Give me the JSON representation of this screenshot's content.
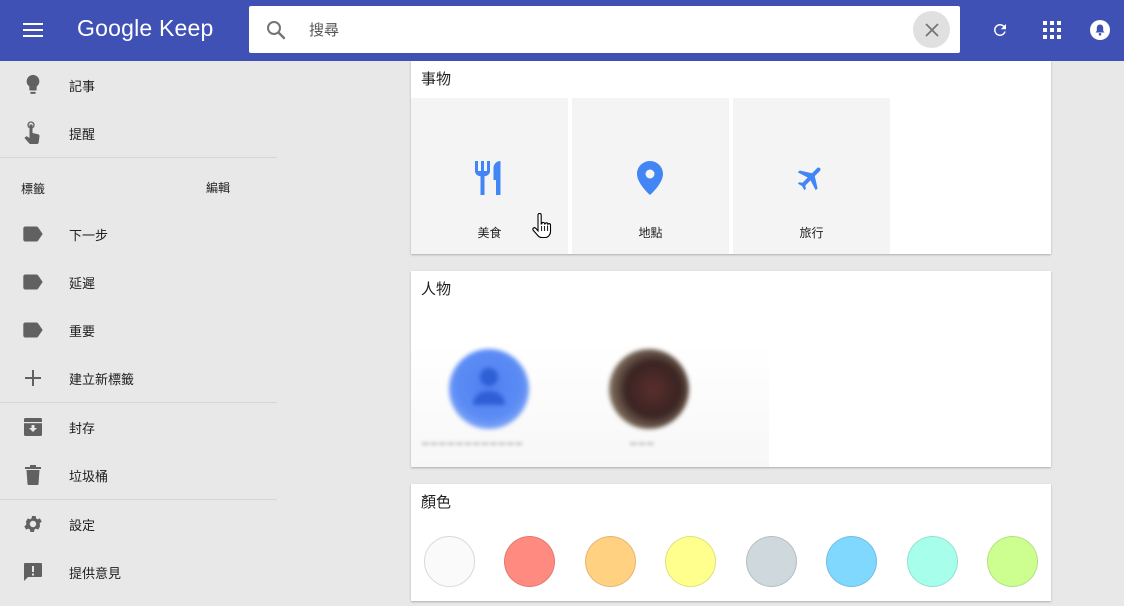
{
  "app": {
    "title": "Google Keep"
  },
  "search": {
    "placeholder": "搜尋"
  },
  "sidebar": {
    "items": [
      {
        "label": "記事",
        "icon": "lightbulb-icon"
      },
      {
        "label": "提醒",
        "icon": "reminder-hand-icon"
      }
    ],
    "labels_header": "標籤",
    "labels_edit": "編輯",
    "labels": [
      {
        "label": "下一步",
        "icon": "label-icon"
      },
      {
        "label": "延遲",
        "icon": "label-icon"
      },
      {
        "label": "重要",
        "icon": "label-icon"
      }
    ],
    "create_label": "建立新標籤",
    "archive": "封存",
    "trash": "垃圾桶",
    "settings": "設定",
    "feedback": "提供意見"
  },
  "things": {
    "title": "事物",
    "tiles": [
      {
        "label": "美食",
        "icon": "food-icon"
      },
      {
        "label": "地點",
        "icon": "place-icon"
      },
      {
        "label": "旅行",
        "icon": "flight-icon"
      }
    ]
  },
  "people": {
    "title": "人物"
  },
  "colors": {
    "title": "顏色",
    "swatches": [
      "#fafafa",
      "#ff8a80",
      "#ffd180",
      "#ffff8d",
      "#cfd8dc",
      "#80d8ff",
      "#a7ffeb",
      "#ccff90"
    ]
  },
  "theme": {
    "header": "#3f51b5",
    "accent": "#4285f4"
  }
}
